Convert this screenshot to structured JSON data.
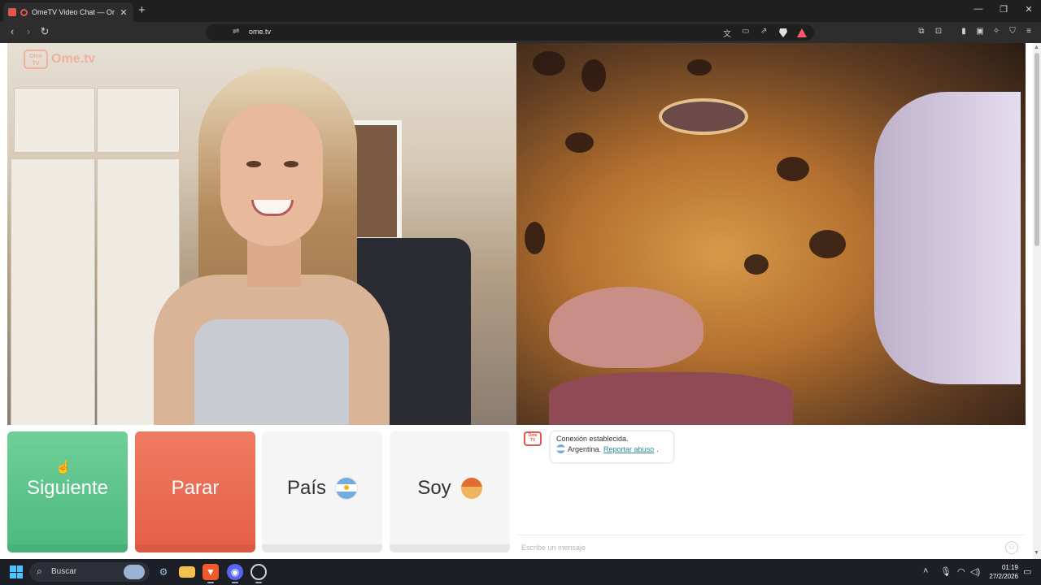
{
  "browser": {
    "tab_title": "OmeTV Video Chat — Omeg",
    "tab_close": "✕",
    "new_tab": "+",
    "url": "ome.tv",
    "window_controls": {
      "minimize": "—",
      "maximize": "❐",
      "close": "✕"
    }
  },
  "page": {
    "logo_badge": "Ome TV",
    "logo_text": "Ome.tv",
    "buttons": {
      "next": "Siguiente",
      "stop": "Parar",
      "country": "País",
      "gender": "Soy"
    },
    "chat": {
      "logo_badge": "Ome TV",
      "status": "Conexión establecida.",
      "country": "Argentina.",
      "report": "Reportar abuso",
      "report_suffix": ".",
      "input_placeholder": "Escribe un mensaje"
    }
  },
  "taskbar": {
    "search_label": "Buscar",
    "time": "01:19",
    "date": "27/2/2026"
  },
  "colors": {
    "next_button": "#5cc48b",
    "stop_button": "#ea6b52",
    "accent_link": "#2a8a9c"
  }
}
